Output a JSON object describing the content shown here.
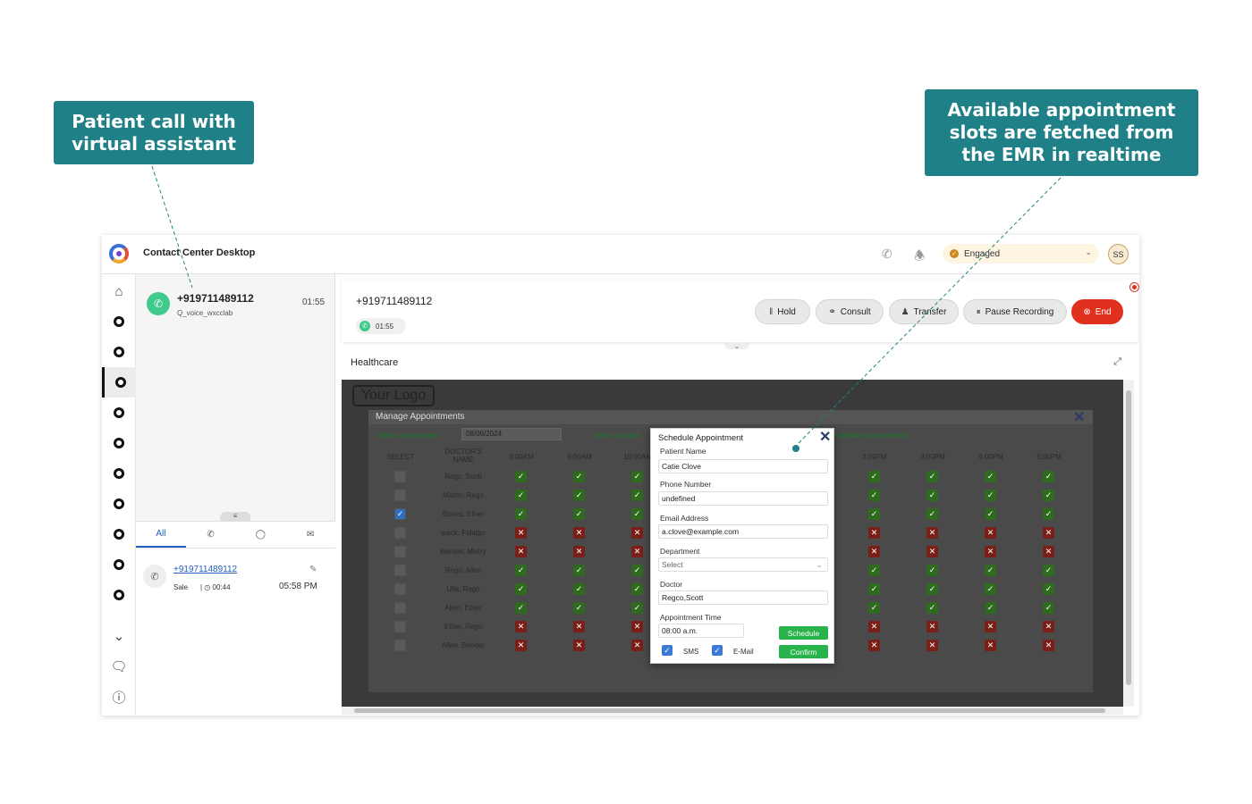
{
  "callouts": {
    "left": "Patient call with virtual assistant",
    "right": "Available appointment slots are fetched from the EMR in realtime"
  },
  "topbar": {
    "title": "Contact Center Desktop",
    "status": "Engaged",
    "avatar_initials": "SS"
  },
  "task": {
    "number": "+919711489112",
    "queue": "Q_voice_wxcclab",
    "timer": "01:55"
  },
  "history": {
    "tabs": [
      "All",
      "call",
      "chat",
      "email"
    ],
    "entry": {
      "number": "+919711489112",
      "type": "Sale",
      "duration": "00:44",
      "time": "05:58 PM"
    }
  },
  "interaction": {
    "number": "+919711489112",
    "timer": "01:55",
    "controls": {
      "hold": "Hold",
      "consult": "Consult",
      "transfer": "Transfer",
      "pause": "Pause Recording",
      "end": "End"
    }
  },
  "widget": {
    "title": "Healthcare"
  },
  "emr": {
    "logo": "Your Logo",
    "manage_title": "Manage Appointments",
    "select_appointment": "Select Appointment",
    "date": "08/06/2024",
    "select_location": "Select location",
    "available": "Available Appointments -",
    "columns": [
      "SELECT",
      "DOCTOR'S NAME",
      "8:00AM",
      "9:00AM",
      "10:00AM",
      "2:00PM",
      "3:00PM",
      "4:00PM",
      "5:00PM"
    ],
    "rows": [
      {
        "name": "Rego, Scott",
        "sel": false,
        "slots": [
          1,
          1,
          1,
          1,
          1,
          1,
          1
        ]
      },
      {
        "name": "Martin, Rego",
        "sel": false,
        "slots": [
          1,
          1,
          1,
          1,
          1,
          1,
          1
        ]
      },
      {
        "name": "Bones, Ether",
        "sel": true,
        "slots": [
          1,
          1,
          1,
          1,
          1,
          1,
          1
        ]
      },
      {
        "name": "wack, Fidalgo",
        "sel": false,
        "slots": [
          0,
          0,
          0,
          0,
          0,
          0,
          0
        ]
      },
      {
        "name": "Bender, Mistry",
        "sel": false,
        "slots": [
          0,
          0,
          0,
          0,
          0,
          0,
          0
        ]
      },
      {
        "name": "Rego, Allen",
        "sel": false,
        "slots": [
          1,
          1,
          1,
          1,
          1,
          1,
          1
        ]
      },
      {
        "name": "Ulla, Rego",
        "sel": false,
        "slots": [
          1,
          1,
          1,
          1,
          1,
          1,
          1
        ]
      },
      {
        "name": "Allen, Ether",
        "sel": false,
        "slots": [
          1,
          1,
          1,
          1,
          1,
          1,
          1
        ]
      },
      {
        "name": "Ether, Rego",
        "sel": false,
        "slots": [
          0,
          0,
          0,
          0,
          0,
          0,
          0
        ]
      },
      {
        "name": "Allen, Bender",
        "sel": false,
        "slots": [
          0,
          0,
          0,
          0,
          0,
          0,
          0
        ]
      }
    ]
  },
  "schedule": {
    "title": "Schedule Appointment",
    "patient_name_label": "Patient Name",
    "patient_name": "Catie Clove",
    "phone_label": "Phone Number",
    "phone": "undefined",
    "email_label": "Email Address",
    "email": "a.clove@example.com",
    "department_label": "Department",
    "department_placeholder": "Select",
    "doctor_label": "Doctor",
    "doctor": "Regco,Scott",
    "time_label": "Appointment Time",
    "time": "08:00 a.m.",
    "schedule_btn": "Schedule",
    "confirm_btn": "Confirm",
    "sms_label": "SMS",
    "email_cb_label": "E-Mail"
  },
  "colors": {
    "callout": "#1f8088",
    "end_button": "#e0301e",
    "accent_green": "#28b34b"
  }
}
